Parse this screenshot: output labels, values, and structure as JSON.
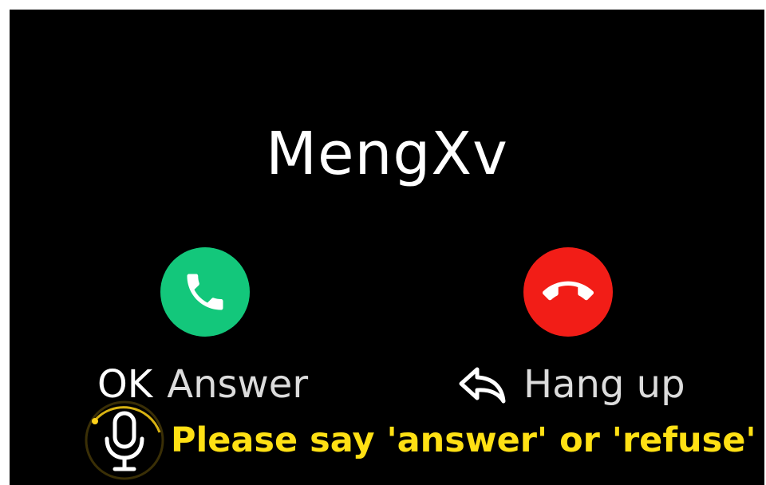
{
  "call": {
    "caller_name": "MengXv"
  },
  "actions": {
    "answer": {
      "key_hint": "OK",
      "label": "Answer",
      "icon": "phone-answer-icon",
      "color": "#13c77b"
    },
    "hangup": {
      "icon_hint": "back-arrow-icon",
      "label": "Hang up",
      "icon": "phone-hangup-icon",
      "color": "#f21d17"
    }
  },
  "voice": {
    "icon": "microphone-icon",
    "prompt": "Please say 'answer' or 'refuse'",
    "prompt_color": "#ffe014"
  }
}
